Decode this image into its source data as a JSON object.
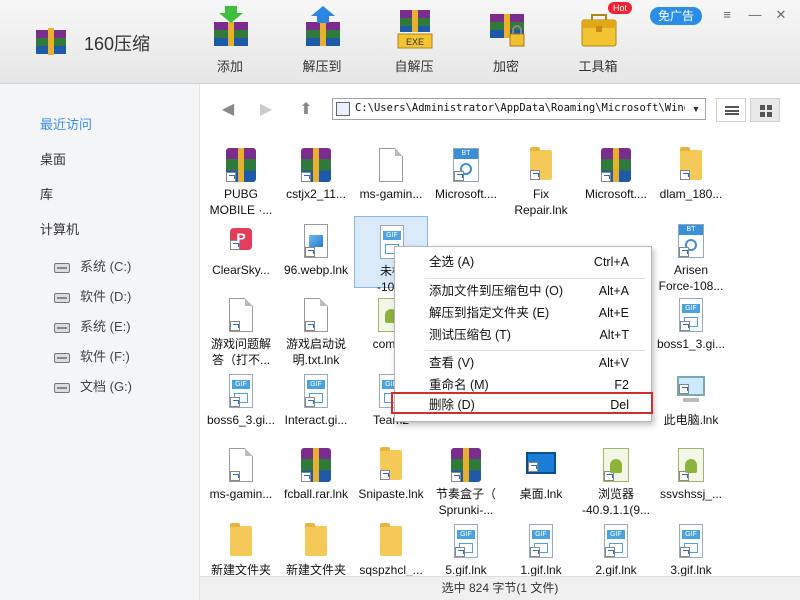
{
  "app": {
    "title": "160压缩",
    "no_ad": "免广告",
    "hot_badge": "Hot"
  },
  "toolbar": {
    "add": "添加",
    "extract_to": "解压到",
    "self_extract": "自解压",
    "encrypt": "加密",
    "toolbox": "工具箱",
    "self_extract_tag": "EXE"
  },
  "window": {
    "minimize": "—",
    "maximize": "☐",
    "close": "✕"
  },
  "sidebar": {
    "recent": "最近访问",
    "desktop": "桌面",
    "library": "库",
    "computer": "计算机",
    "drives": [
      "系统 (C:)",
      "软件 (D:)",
      "系统 (E:)",
      "软件 (F:)",
      "文档 (G:)"
    ]
  },
  "nav": {
    "path": "C:\\Users\\Administrator\\AppData\\Roaming\\Microsoft\\Window",
    "back": "◀",
    "forward": "▶",
    "up": "⬆",
    "dropdown": "▼"
  },
  "files": [
    "PUBG\nMOBILE ·...",
    "cstjx2_11...",
    "ms-gamin...",
    "Microsoft....",
    "Fix\nRepair.lnk",
    "Microsoft....",
    "dlam_180...",
    "ClearSky...",
    "96.webp.lnk",
    "未标\n-10.gi",
    "",
    "",
    "",
    "Arisen\nForce-108...",
    "游戏问题解\n答（打不...",
    "游戏启动说\n明.txt.lnk",
    "com.pr",
    "",
    "",
    "",
    "boss1_3.gi...",
    "boss6_3.gi...",
    "Interact.gi...",
    "Team2",
    "",
    "txt.lnk",
    "",
    "此电脑.lnk",
    "ms-gamin...",
    "fcball.rar.lnk",
    "Snipaste.lnk",
    "节奏盒子（\nSprunki-...",
    "桌面.lnk",
    "浏览器\n-40.9.1.1(9...",
    "ssvshssj_...",
    "新建文件夹",
    "新建文件夹",
    "sqspzhcl_...",
    "5.gif.lnk",
    "1.gif.lnk",
    "2.gif.lnk",
    "3.gif.lnk"
  ],
  "icon_tags": {
    "gif": "GIF",
    "bt": "BT"
  },
  "status": {
    "text": "选中  824 字节(1 文件)"
  },
  "context_menu": {
    "items": [
      {
        "label": "全选 (A)",
        "shortcut": "Ctrl+A"
      },
      {
        "label": "添加文件到压缩包中 (O)",
        "shortcut": "Alt+A"
      },
      {
        "label": "解压到指定文件夹 (E)",
        "shortcut": "Alt+E"
      },
      {
        "label": "测试压缩包 (T)",
        "shortcut": "Alt+T"
      },
      {
        "label": "查看 (V)",
        "shortcut": "Alt+V"
      },
      {
        "label": "重命名 (M)",
        "shortcut": "F2"
      },
      {
        "label": "删除 (D)",
        "shortcut": "Del"
      }
    ]
  }
}
